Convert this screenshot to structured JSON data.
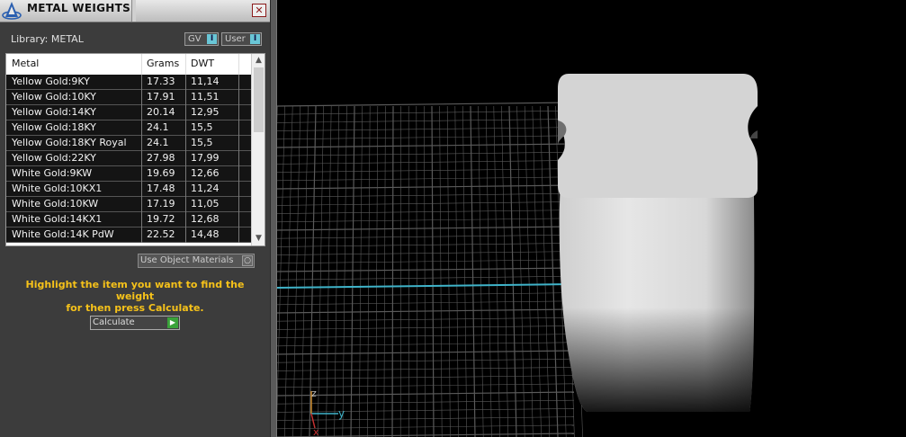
{
  "window": {
    "title": "METAL WEIGHTS",
    "close_glyph": "✕"
  },
  "library": {
    "label": "Library:",
    "value": "METAL"
  },
  "toggles": [
    {
      "label": "GV",
      "indicator": "I"
    },
    {
      "label": "User",
      "indicator": "I"
    }
  ],
  "table": {
    "headers": [
      "Metal",
      "Grams",
      "DWT"
    ],
    "rows": [
      {
        "metal": "Yellow Gold:9KY",
        "grams": "17.33",
        "dwt": "11,14"
      },
      {
        "metal": "Yellow Gold:10KY",
        "grams": "17.91",
        "dwt": "11,51"
      },
      {
        "metal": "Yellow Gold:14KY",
        "grams": "20.14",
        "dwt": "12,95"
      },
      {
        "metal": "Yellow Gold:18KY",
        "grams": "24.1",
        "dwt": "15,5"
      },
      {
        "metal": "Yellow Gold:18KY Royal",
        "grams": "24.1",
        "dwt": "15,5"
      },
      {
        "metal": "Yellow Gold:22KY",
        "grams": "27.98",
        "dwt": "17,99"
      },
      {
        "metal": "White Gold:9KW",
        "grams": "19.69",
        "dwt": "12,66"
      },
      {
        "metal": "White Gold:10KX1",
        "grams": "17.48",
        "dwt": "11,24"
      },
      {
        "metal": "White Gold:10KW",
        "grams": "17.19",
        "dwt": "11,05"
      },
      {
        "metal": "White Gold:14KX1",
        "grams": "19.72",
        "dwt": "12,68"
      },
      {
        "metal": "White Gold:14K PdW",
        "grams": "22.52",
        "dwt": "14,48"
      }
    ]
  },
  "use_object_materials": {
    "label": "Use Object Materials"
  },
  "instruction": {
    "line1": "Highlight the item you want to find the weight",
    "line2": "for then press Calculate."
  },
  "calculate": {
    "label": "Calculate"
  },
  "viewport": {
    "axis_z": "z",
    "axis_y": "y",
    "axis_x": "x"
  },
  "colors": {
    "panel_bg": "#3c3c3c",
    "instruction": "#f6c21a",
    "grid_line": "#5a5a5a",
    "horizon": "#3fb3c9",
    "toggle_indicator": "#69c6d6",
    "calc_go": "#3aa33a"
  }
}
